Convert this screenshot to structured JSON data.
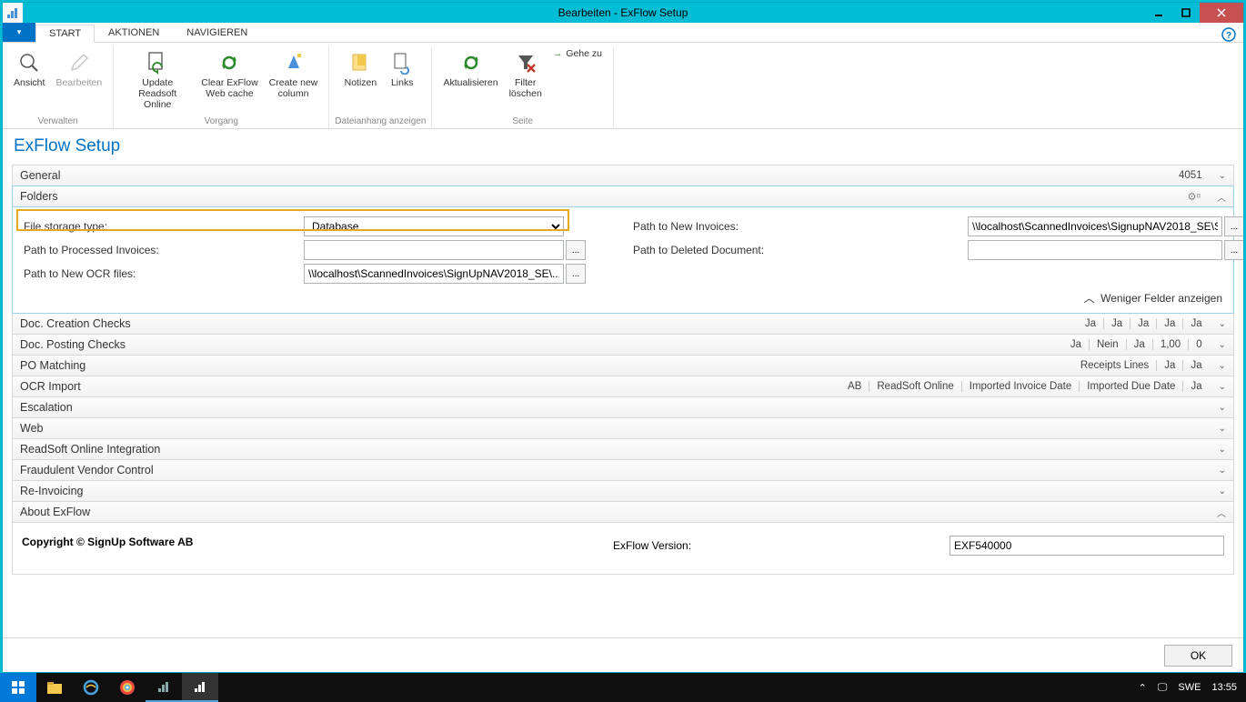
{
  "window": {
    "title": "Bearbeiten - ExFlow Setup"
  },
  "ribbon": {
    "tabs": {
      "start": "START",
      "aktionen": "AKTIONEN",
      "navigieren": "NAVIGIEREN"
    },
    "items": {
      "ansicht": "Ansicht",
      "bearbeiten": "Bearbeiten",
      "update_readsoft": "Update\nReadsoft Online",
      "clear_cache": "Clear ExFlow\nWeb cache",
      "create_column": "Create new\ncolumn",
      "notizen": "Notizen",
      "links": "Links",
      "aktualisieren": "Aktualisieren",
      "filter_loeschen": "Filter\nlöschen",
      "gehe_zu": "Gehe zu"
    },
    "groups": {
      "verwalten": "Verwalten",
      "vorgang": "Vorgang",
      "dateianhang": "Dateianhang anzeigen",
      "seite": "Seite"
    }
  },
  "page": {
    "title": "ExFlow Setup"
  },
  "fasttabs": {
    "general": {
      "title": "General",
      "summary": "4051"
    },
    "folders": {
      "title": "Folders",
      "file_storage_label": "File storage type:",
      "file_storage_value": "Database",
      "path_processed_label": "Path to Processed Invoices:",
      "path_processed_value": "",
      "path_ocr_label": "Path to New OCR files:",
      "path_ocr_value": "\\\\localhost\\ScannedInvoices\\SignUpNAV2018_SE\\...",
      "path_new_invoices_label": "Path to New Invoices:",
      "path_new_invoices_value": "\\\\localhost\\ScannedInvoices\\SignupNAV2018_SE\\S...",
      "path_deleted_label": "Path to Deleted Document:",
      "path_deleted_value": "",
      "less_fields": "Weniger Felder anzeigen",
      "browse": "..."
    },
    "doc_creation": {
      "title": "Doc. Creation Checks",
      "s1": "Ja",
      "s2": "Ja",
      "s3": "Ja",
      "s4": "Ja",
      "s5": "Ja"
    },
    "doc_posting": {
      "title": "Doc. Posting Checks",
      "s1": "Ja",
      "s2": "Nein",
      "s3": "Ja",
      "s4": "1,00",
      "s5": "0"
    },
    "po_matching": {
      "title": "PO Matching",
      "s1": "Receipts Lines",
      "s2": "Ja",
      "s3": "Ja"
    },
    "ocr_import": {
      "title": "OCR Import",
      "s1": "AB",
      "s2": "ReadSoft Online",
      "s3": "Imported Invoice Date",
      "s4": "Imported Due Date",
      "s5": "Ja"
    },
    "escalation": {
      "title": "Escalation"
    },
    "web": {
      "title": "Web"
    },
    "readsoft_integration": {
      "title": "ReadSoft Online Integration"
    },
    "fraudulent": {
      "title": "Fraudulent Vendor Control"
    },
    "reinvoicing": {
      "title": "Re-Invoicing"
    },
    "about": {
      "title": "About ExFlow",
      "copyright": "Copyright © SignUp Software AB",
      "version_label": "ExFlow Version:",
      "version_value": "EXF540000"
    }
  },
  "buttons": {
    "ok": "OK"
  },
  "taskbar": {
    "lang": "SWE",
    "time": "13:55"
  }
}
